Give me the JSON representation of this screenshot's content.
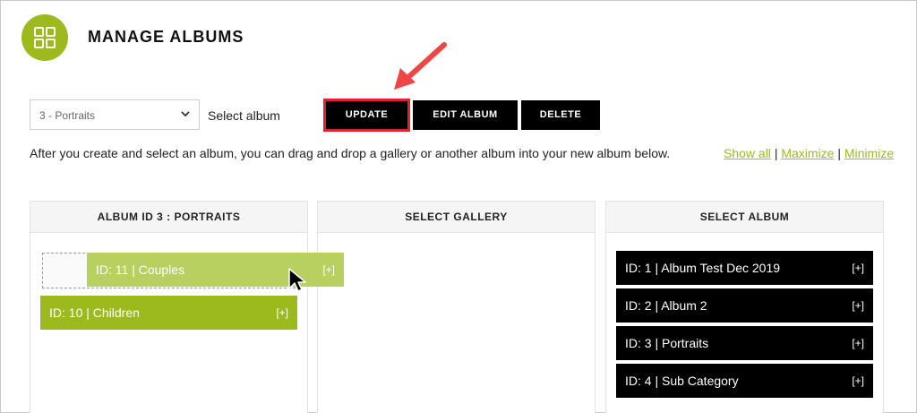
{
  "header": {
    "title": "MANAGE ALBUMS",
    "logo_icon": "grid-icon",
    "accent_color": "#9cba1d"
  },
  "controls": {
    "album_select_value": "3 - Portraits",
    "album_select_label": "Select album",
    "update_label": "UPDATE",
    "edit_album_label": "EDIT ALBUM",
    "delete_label": "DELETE",
    "highlight_color": "#e0202a"
  },
  "instructions": "After you create and select an album, you can drag and drop a gallery or another album into your new album below.",
  "links": {
    "show_all": "Show all",
    "maximize": "Maximize",
    "minimize": "Minimize",
    "separator": "|"
  },
  "panels": {
    "album": {
      "title": "ALBUM ID 3 : PORTRAITS",
      "items": [
        {
          "label": "ID: 10 | Children",
          "action": "[+]"
        }
      ],
      "dragging": {
        "label": "ID: 11 | Couples",
        "action": "[+]"
      }
    },
    "gallery": {
      "title": "SELECT GALLERY",
      "items": []
    },
    "albums": {
      "title": "SELECT ALBUM",
      "items": [
        {
          "label": "ID: 1 | Album Test Dec 2019",
          "action": "[+]"
        },
        {
          "label": "ID: 2 | Album 2",
          "action": "[+]"
        },
        {
          "label": "ID: 3 | Portraits",
          "action": "[+]"
        },
        {
          "label": "ID: 4 | Sub Category",
          "action": "[+]"
        }
      ]
    }
  }
}
